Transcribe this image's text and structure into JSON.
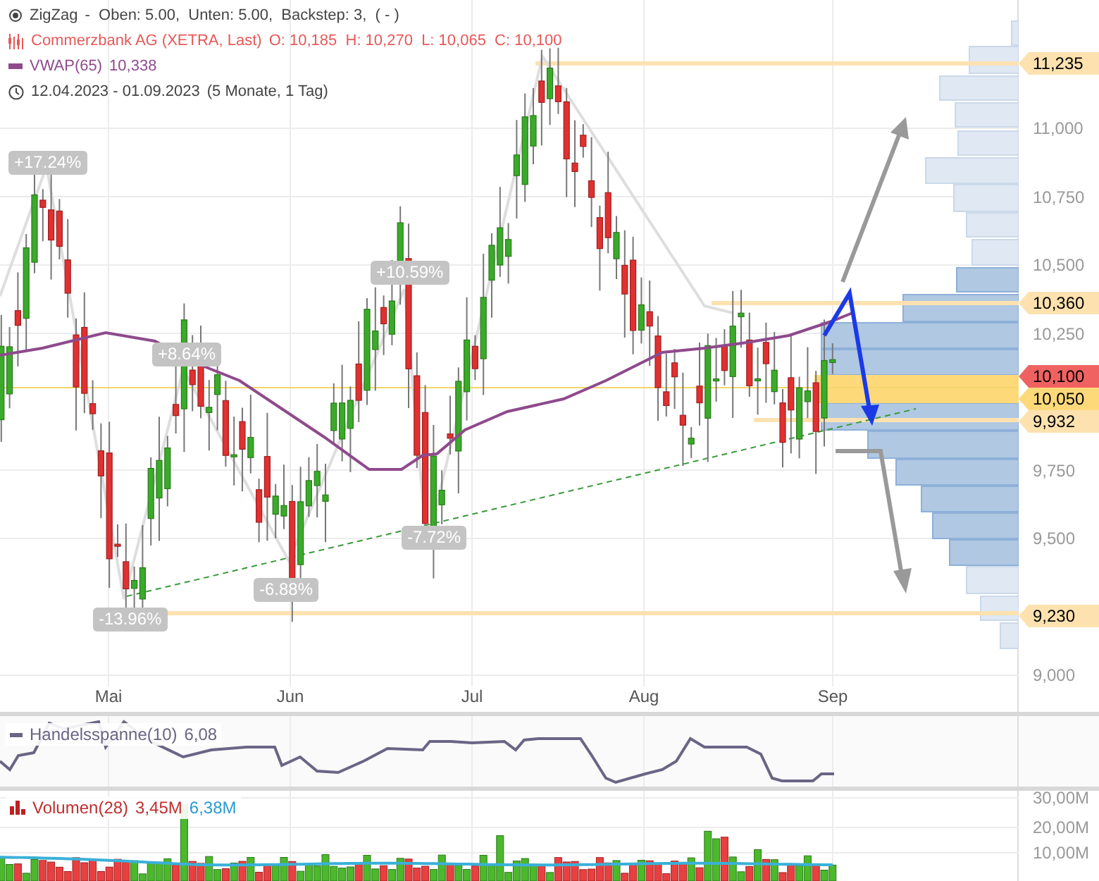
{
  "legend": {
    "zigzag": {
      "name": "ZigZag",
      "params": "-  Oben: 5.00,  Unten: 5.00,  Backstep: 3,  ( - )"
    },
    "instrument": {
      "name": "Commerzbank AG (XETRA, Last)",
      "ohlc": "O: 10,185  H: 10,270  L: 10,065  C: 10,100"
    },
    "vwap": {
      "name": "VWAP(65)",
      "value": "10,338"
    },
    "range": {
      "dates": "12.04.2023 - 01.09.2023",
      "span": "(5 Monate, 1 Tag)"
    }
  },
  "zigzag_labels": [
    "+17.24%",
    "+8.64%",
    "+10.59%",
    "-13.96%",
    "-6.88%",
    "-7.72%"
  ],
  "price_axis": {
    "ticks": [
      "11,000",
      "10,750",
      "10,500",
      "10,250",
      "9,750",
      "9,500",
      "9,000"
    ],
    "level_labels": [
      {
        "value": "11,235",
        "kind": "level"
      },
      {
        "value": "10,360",
        "kind": "level"
      },
      {
        "value": "10,100",
        "kind": "last"
      },
      {
        "value": "10,050",
        "kind": "band"
      },
      {
        "value": "9,932",
        "kind": "level"
      },
      {
        "value": "9,230",
        "kind": "level"
      }
    ]
  },
  "x_axis": [
    "Mai",
    "Jun",
    "Jul",
    "Aug",
    "Sep"
  ],
  "indicator": {
    "name": "Handelsspanne(10)",
    "value": "6,08"
  },
  "volume": {
    "name": "Volumen(28)",
    "value": "3,45M",
    "average": "6,38M",
    "ticks": [
      "30,00M",
      "20,00M",
      "10,00M"
    ]
  }
}
